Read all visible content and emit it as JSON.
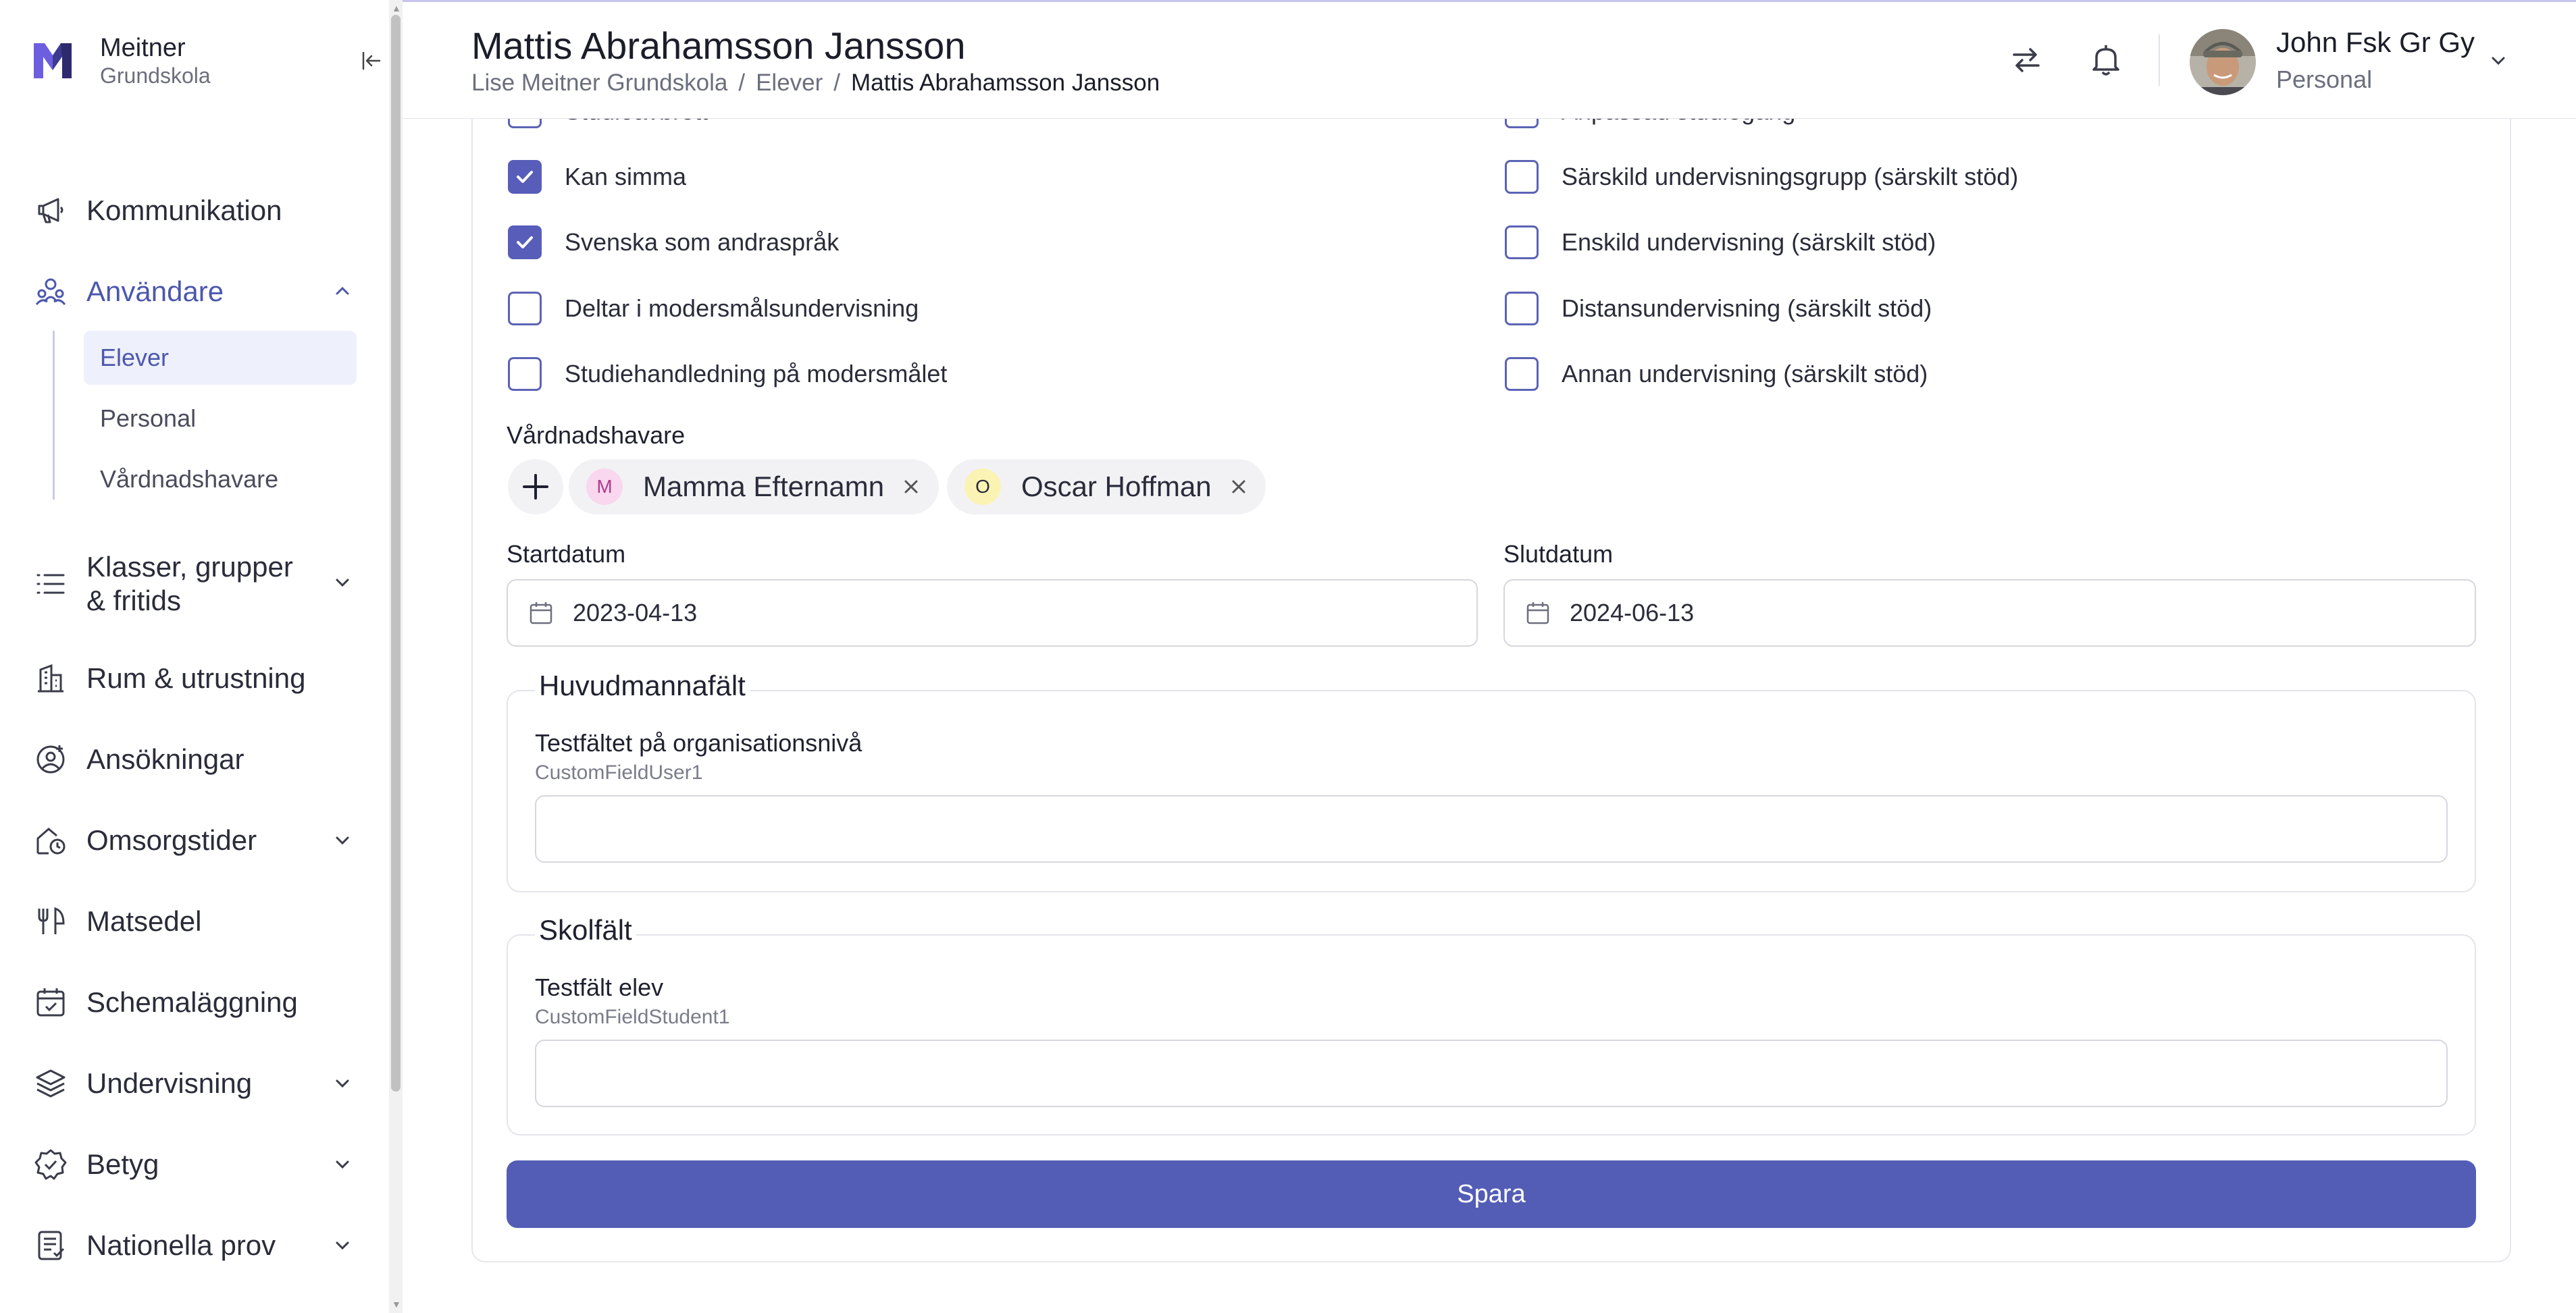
{
  "brand": {
    "name": "Meitner",
    "sub": "Grundskola"
  },
  "sidebar": {
    "items": [
      {
        "label": "Kommunikation",
        "icon": "megaphone-icon"
      },
      {
        "label": "Användare",
        "icon": "users-icon",
        "active": true,
        "expanded": true
      },
      {
        "label": "Klasser, grupper & fritids",
        "icon": "list-icon"
      },
      {
        "label": "Rum & utrustning",
        "icon": "building-icon"
      },
      {
        "label": "Ansökningar",
        "icon": "user-add-icon"
      },
      {
        "label": "Omsorgstider",
        "icon": "home-clock-icon"
      },
      {
        "label": "Matsedel",
        "icon": "fork-knife-icon"
      },
      {
        "label": "Schemaläggning",
        "icon": "calendar-icon"
      },
      {
        "label": "Undervisning",
        "icon": "layers-icon"
      },
      {
        "label": "Betyg",
        "icon": "badge-check-icon"
      },
      {
        "label": "Nationella prov",
        "icon": "document-icon"
      }
    ],
    "klasser_line1": "Klasser, grupper",
    "klasser_line2": "& fritids",
    "subitems": [
      "Elever",
      "Personal",
      "Vårdnadshavare"
    ]
  },
  "header": {
    "title": "Mattis Abrahamsson Jansson",
    "breadcrumb": [
      "Lise Meitner Grundskola",
      "Elever",
      "Mattis Abrahamsson Jansson"
    ],
    "breadcrumb_sep": "/",
    "user_name": "John Fsk Gr Gy",
    "user_role": "Personal"
  },
  "checkboxes_left": [
    {
      "label": "Studieavbrott",
      "checked": false
    },
    {
      "label": "Kan simma",
      "checked": true
    },
    {
      "label": "Svenska som andraspråk",
      "checked": true
    },
    {
      "label": "Deltar i modersmålsundervisning",
      "checked": false
    },
    {
      "label": "Studiehandledning på modersmålet",
      "checked": false
    }
  ],
  "checkboxes_right": [
    {
      "label": "Anpassad studiegång",
      "checked": false
    },
    {
      "label": "Särskild undervisningsgrupp (särskilt stöd)",
      "checked": false
    },
    {
      "label": "Enskild undervisning (särskilt stöd)",
      "checked": false
    },
    {
      "label": "Distansundervisning (särskilt stöd)",
      "checked": false
    },
    {
      "label": "Annan undervisning (särskilt stöd)",
      "checked": false
    }
  ],
  "guardians": {
    "label": "Vårdnadshavare",
    "items": [
      {
        "initial": "M",
        "name": "Mamma Efternamn",
        "color": "#f9d7ef",
        "initial_color": "#b03c8a"
      },
      {
        "initial": "O",
        "name": "Oscar Hoffman",
        "color": "#fbf3b4",
        "initial_color": "#2a2c3a"
      }
    ]
  },
  "dates": {
    "start_label": "Startdatum",
    "start_value": "2023-04-13",
    "end_label": "Slutdatum",
    "end_value": "2024-06-13"
  },
  "huvudman": {
    "legend": "Huvudmannafält",
    "field_label": "Testfältet på organisationsnivå",
    "field_key": "CustomFieldUser1",
    "value": ""
  },
  "skol": {
    "legend": "Skolfält",
    "field_label": "Testfält elev",
    "field_key": "CustomFieldStudent1",
    "value": ""
  },
  "save_label": "Spara",
  "colors": {
    "accent": "#535db6",
    "active_text": "#4c57ad",
    "active_bg": "#eef0fb"
  }
}
